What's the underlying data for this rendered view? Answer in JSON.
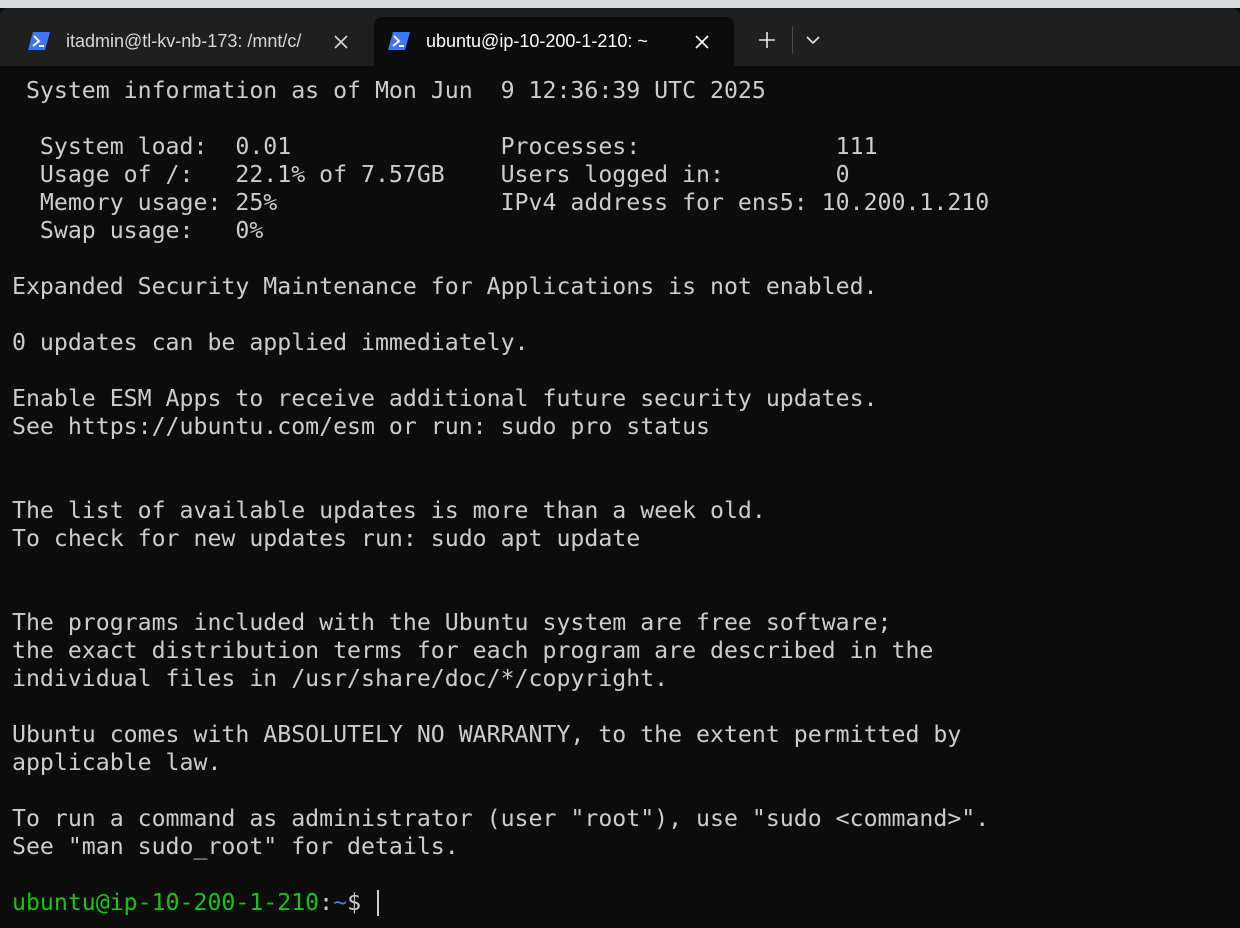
{
  "window": {
    "tabs": [
      {
        "title": "itadmin@tl-kv-nb-173: /mnt/c/",
        "icon": "powershell-icon",
        "active": false
      },
      {
        "title": "ubuntu@ip-10-200-1-210: ~",
        "icon": "powershell-icon",
        "active": true
      }
    ],
    "new_tab_symbol": "+",
    "dropdown_icon": "chevron-down-icon",
    "accent_color": "#3b78ff"
  },
  "terminal": {
    "lines": [
      " System information as of Mon Jun  9 12:36:39 UTC 2025",
      "",
      "  System load:  0.01               Processes:              111",
      "  Usage of /:   22.1% of 7.57GB    Users logged in:        0",
      "  Memory usage: 25%                IPv4 address for ens5: 10.200.1.210",
      "  Swap usage:   0%",
      "",
      "Expanded Security Maintenance for Applications is not enabled.",
      "",
      "0 updates can be applied immediately.",
      "",
      "Enable ESM Apps to receive additional future security updates.",
      "See https://ubuntu.com/esm or run: sudo pro status",
      "",
      "",
      "The list of available updates is more than a week old.",
      "To check for new updates run: sudo apt update",
      "",
      "",
      "The programs included with the Ubuntu system are free software;",
      "the exact distribution terms for each program are described in the",
      "individual files in /usr/share/doc/*/copyright.",
      "",
      "Ubuntu comes with ABSOLUTELY NO WARRANTY, to the extent permitted by",
      "applicable law.",
      "",
      "To run a command as administrator (user \"root\"), use \"sudo <command>\".",
      "See \"man sudo_root\" for details.",
      ""
    ],
    "prompt": {
      "user_host": "ubuntu@ip-10-200-1-210",
      "separator": ":",
      "path": "~",
      "symbol": "$ "
    },
    "colors": {
      "background": "#0c0c0c",
      "foreground": "#cccccc",
      "prompt_user": "#16c60c",
      "prompt_path": "#3b78ff"
    }
  }
}
